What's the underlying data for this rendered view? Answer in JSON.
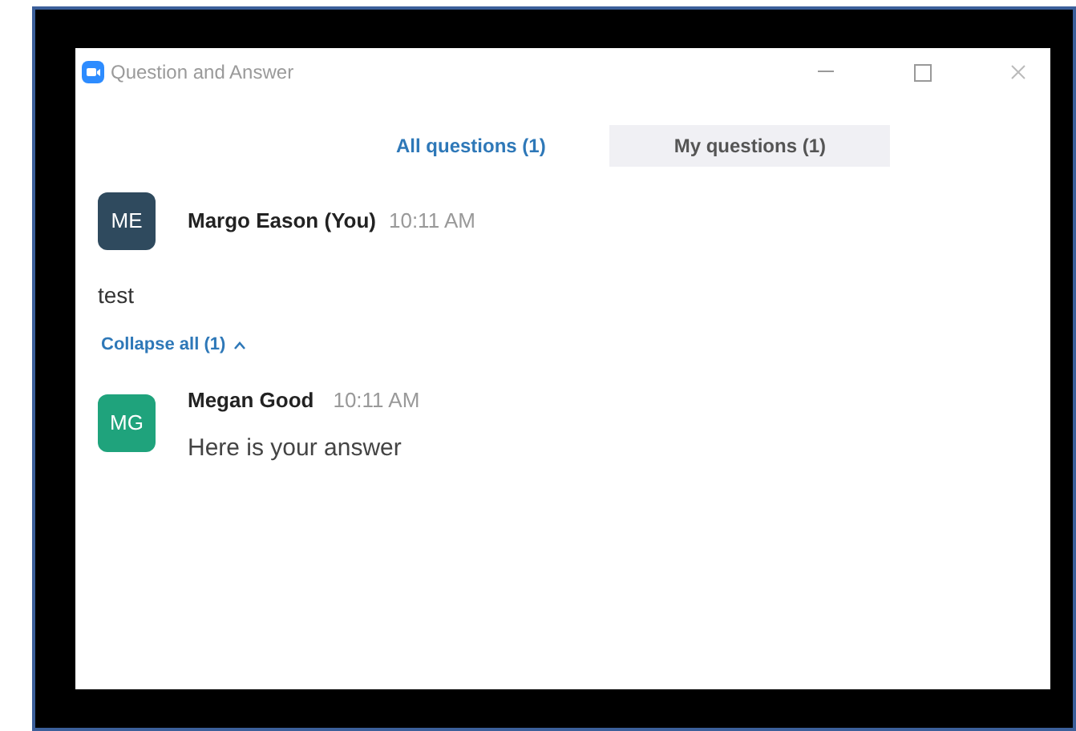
{
  "window": {
    "title": "Question and Answer"
  },
  "tabs": [
    {
      "label": "All questions (1)",
      "selected": true
    },
    {
      "label": "My questions (1)",
      "selected": false
    }
  ],
  "question": {
    "initials": "ME",
    "color": "#2f4a5e",
    "name": "Margo Eason (You)",
    "time": "10:11 AM",
    "text": "test"
  },
  "replies_toggle": {
    "label": "Collapse all (1)",
    "expanded": true
  },
  "answers": [
    {
      "initials": "MG",
      "color": "#1fa37c",
      "name": "Megan Good",
      "time": "10:11 AM",
      "text": "Here is your answer"
    }
  ]
}
